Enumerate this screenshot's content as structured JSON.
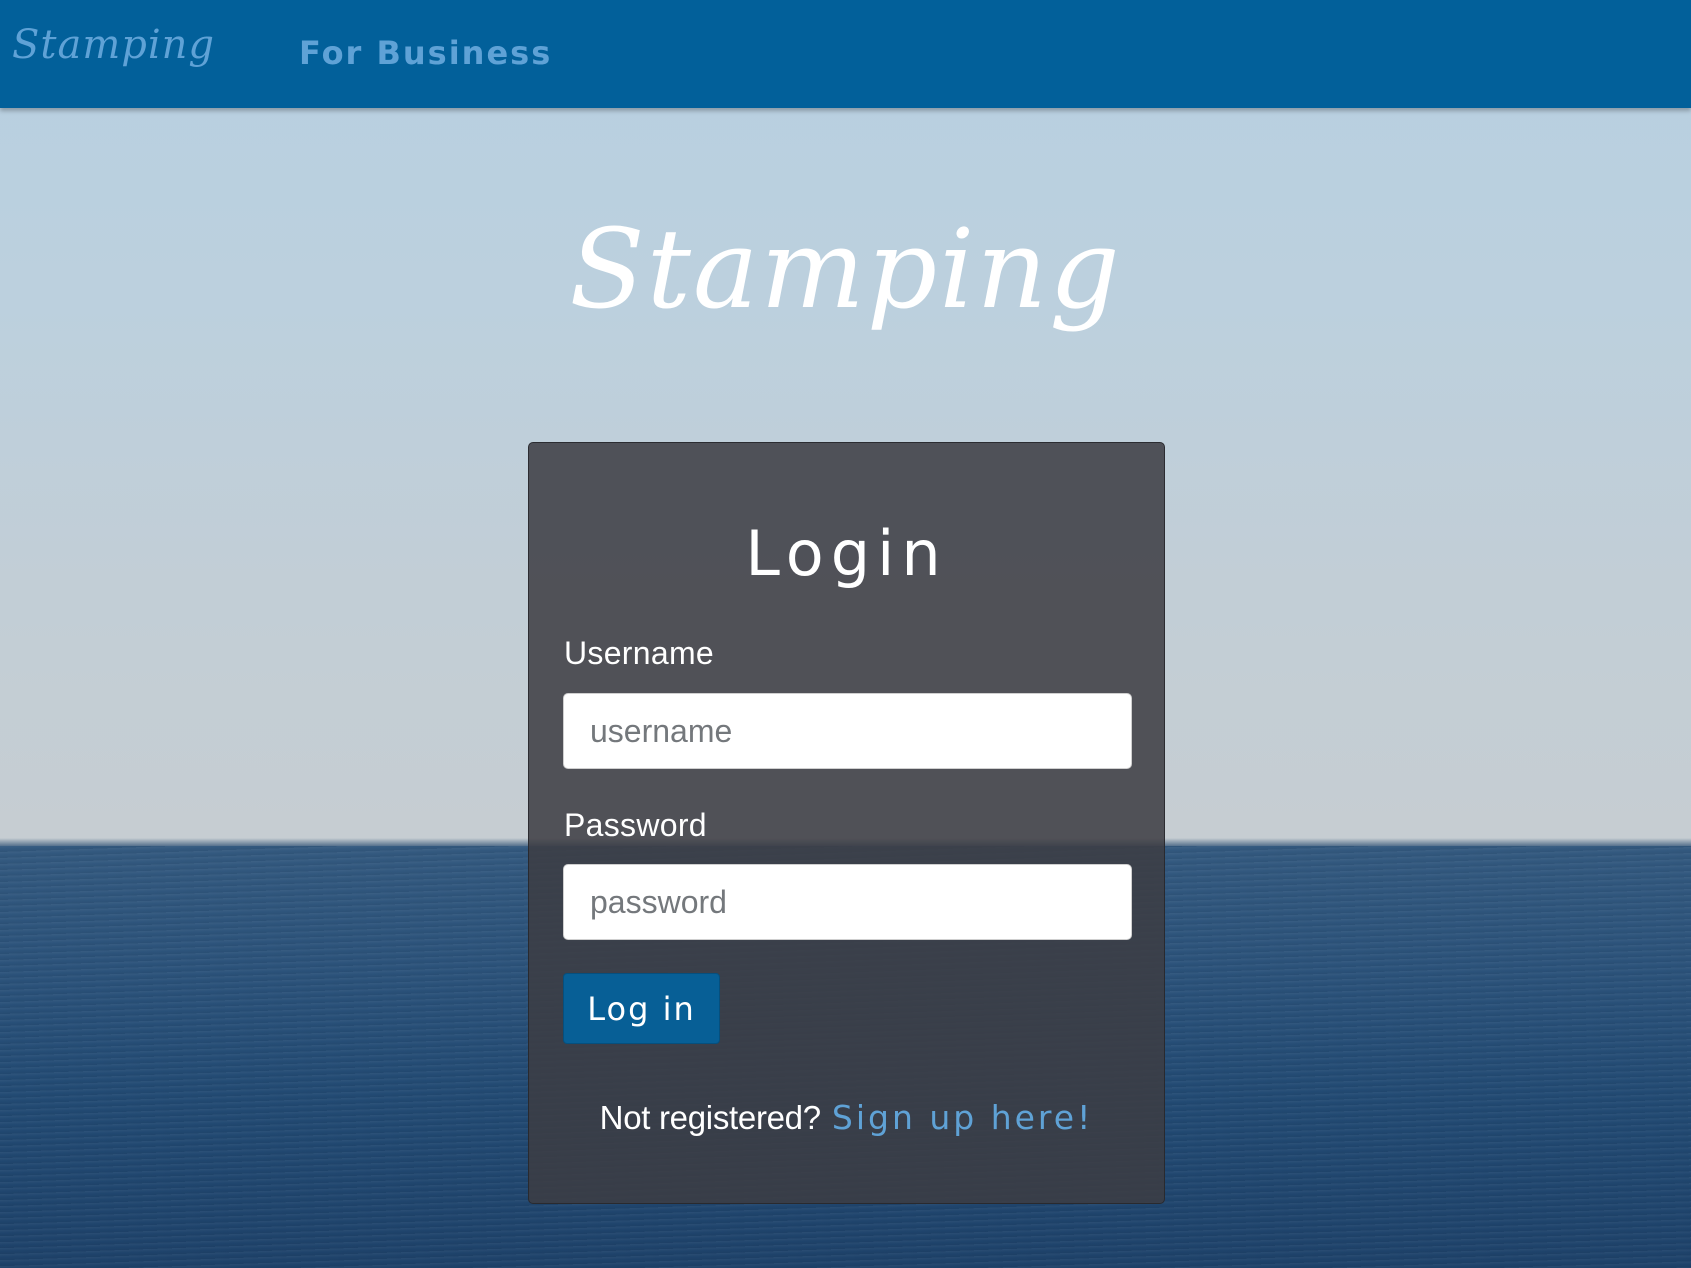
{
  "navbar": {
    "brand": "Stamping",
    "links": [
      {
        "label": "For Business"
      }
    ]
  },
  "hero": {
    "title": "Stamping"
  },
  "login": {
    "title": "Login",
    "username_label": "Username",
    "username_placeholder": "username",
    "username_value": "",
    "password_label": "Password",
    "password_placeholder": "password",
    "password_value": "",
    "submit_label": "Log in",
    "signup_prompt": "Not registered?",
    "signup_link": "Sign up here!"
  },
  "colors": {
    "navbar_bg": "#02609a",
    "accent_link": "#5fa2d6",
    "button_bg": "#075f96",
    "card_bg": "rgba(60,60,66,0.86)"
  }
}
